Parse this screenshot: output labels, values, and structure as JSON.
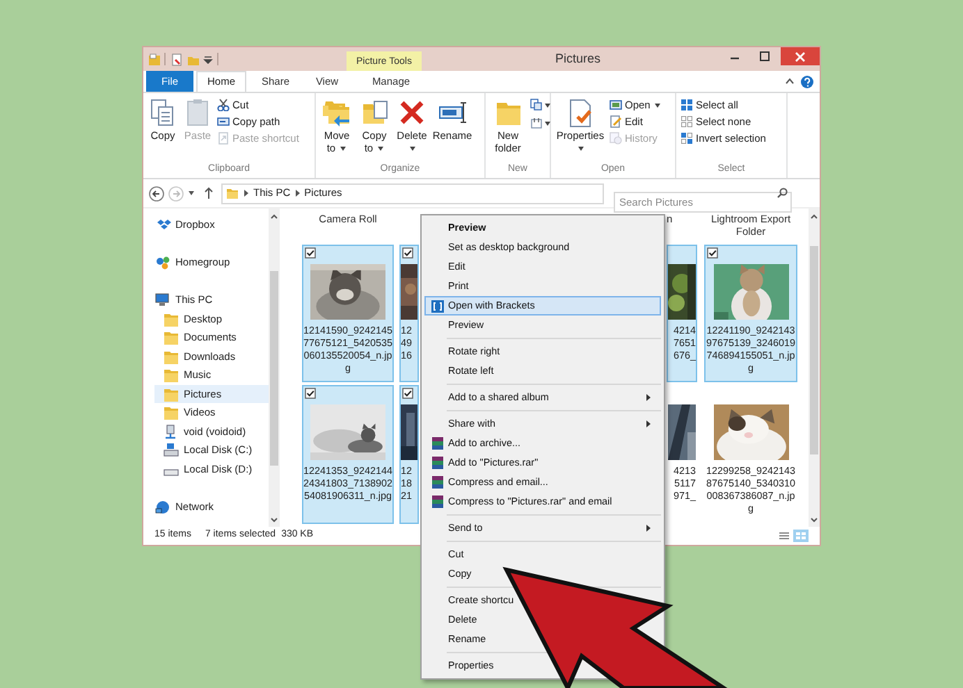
{
  "window": {
    "title": "Pictures",
    "context_label": "Picture Tools"
  },
  "tabs": [
    {
      "label": "File",
      "kind": "file",
      "selected": false
    },
    {
      "label": "Home",
      "kind": "tab",
      "selected": true
    },
    {
      "label": "Share",
      "kind": "tab",
      "selected": false
    },
    {
      "label": "View",
      "kind": "tab",
      "selected": false
    },
    {
      "label": "Manage",
      "kind": "tab",
      "selected": false
    }
  ],
  "ribbon_groups": [
    {
      "name": "Clipboard",
      "commands": [
        {
          "label": "Copy",
          "kind": "large",
          "disabled": false,
          "dropdown": false
        },
        {
          "label": "Paste",
          "kind": "large",
          "disabled": true,
          "dropdown": false
        },
        {
          "label": "Cut",
          "kind": "small",
          "disabled": false,
          "dropdown": false
        },
        {
          "label": "Copy path",
          "kind": "small",
          "disabled": false,
          "dropdown": false
        },
        {
          "label": "Paste shortcut",
          "kind": "small",
          "disabled": true,
          "dropdown": false
        }
      ]
    },
    {
      "name": "Organize",
      "commands": [
        {
          "label": "Move to",
          "kind": "large",
          "disabled": false,
          "dropdown": true
        },
        {
          "label": "Copy to",
          "kind": "large",
          "disabled": false,
          "dropdown": true
        },
        {
          "label": "Delete",
          "kind": "large",
          "disabled": false,
          "dropdown": true
        },
        {
          "label": "Rename",
          "kind": "large",
          "disabled": false,
          "dropdown": false
        }
      ]
    },
    {
      "name": "New",
      "commands": [
        {
          "label": "New folder",
          "kind": "large",
          "disabled": false,
          "dropdown": false
        }
      ]
    },
    {
      "name": "Open",
      "commands": [
        {
          "label": "Properties",
          "kind": "large",
          "disabled": false,
          "dropdown": true
        },
        {
          "label": "Open",
          "kind": "small",
          "disabled": false,
          "dropdown": true
        },
        {
          "label": "Edit",
          "kind": "small",
          "disabled": false,
          "dropdown": false
        },
        {
          "label": "History",
          "kind": "small",
          "disabled": true,
          "dropdown": false
        }
      ]
    },
    {
      "name": "Select",
      "commands": [
        {
          "label": "Select all",
          "kind": "small",
          "disabled": false,
          "dropdown": false
        },
        {
          "label": "Select none",
          "kind": "small",
          "disabled": false,
          "dropdown": false
        },
        {
          "label": "Invert selection",
          "kind": "small",
          "disabled": false,
          "dropdown": false
        }
      ]
    }
  ],
  "address": {
    "path": [
      "This PC",
      "Pictures"
    ],
    "search_placeholder": "Search Pictures"
  },
  "navigation": [
    {
      "label": "Dropbox",
      "kind": "cloud",
      "selected": false
    },
    {
      "label": "Homegroup",
      "kind": "group",
      "selected": false
    },
    {
      "label": "This PC",
      "kind": "computer",
      "selected": false,
      "children": [
        {
          "label": "Desktop",
          "kind": "folder",
          "selected": false
        },
        {
          "label": "Documents",
          "kind": "folder",
          "selected": false
        },
        {
          "label": "Downloads",
          "kind": "folder",
          "selected": false
        },
        {
          "label": "Music",
          "kind": "folder",
          "selected": false
        },
        {
          "label": "Pictures",
          "kind": "folder",
          "selected": true
        },
        {
          "label": "Videos",
          "kind": "folder",
          "selected": false
        },
        {
          "label": "void (voidoid)",
          "kind": "network_drive",
          "selected": false
        },
        {
          "label": "Local Disk (C:)",
          "kind": "system_disk",
          "selected": false
        },
        {
          "label": "Local Disk (D:)",
          "kind": "disk",
          "selected": false
        }
      ]
    },
    {
      "label": "Network",
      "kind": "network",
      "selected": false
    }
  ],
  "columns": [
    {
      "header": "Camera Roll",
      "tiles": [
        {
          "name": "12141590_924214577675121_5420535060135520054_n.jpg",
          "checked": true,
          "selected": true
        },
        {
          "name": "12241353_924214424341803_713890254081906311_n.jpg",
          "checked": true,
          "selected": true
        }
      ]
    },
    {
      "tiles": [
        {
          "name_lines": [
            "12",
            "49",
            "16"
          ],
          "checked": true,
          "selected": true
        },
        {
          "name_lines": [
            "12",
            "18",
            "21"
          ],
          "checked": true,
          "selected": true
        }
      ]
    },
    {
      "header": "n",
      "tiles": [
        {
          "name_lines": [
            "4214",
            "7651",
            "676_"
          ],
          "selected": true
        },
        {
          "name_lines": [
            "4213",
            "5117",
            "971_"
          ],
          "selected": false
        }
      ]
    },
    {
      "header": "Lightroom Export Folder",
      "tiles": [
        {
          "name": "12241190_924214397675139_3246019746894155051_n.jpg",
          "checked": true,
          "selected": true
        },
        {
          "name": "12299258_924214387675140_5340310008367386087_n.jpg",
          "checked": false,
          "selected": false
        }
      ]
    }
  ],
  "status_bar": {
    "item_count": "15 items",
    "selection": "7 items selected",
    "size": "330 KB"
  },
  "context_menu": [
    [
      {
        "label": "Preview",
        "kind": "plain",
        "selected": false,
        "bold": true
      },
      {
        "label": "Set as desktop background",
        "kind": "plain",
        "selected": false
      },
      {
        "label": "Edit",
        "kind": "plain",
        "selected": false
      },
      {
        "label": "Print",
        "kind": "plain",
        "selected": false
      },
      {
        "label": "Open with Brackets",
        "kind": "app",
        "selected": true
      },
      {
        "label": "Preview",
        "kind": "plain",
        "selected": false
      }
    ],
    [
      {
        "label": "Rotate right",
        "kind": "plain",
        "selected": false
      },
      {
        "label": "Rotate left",
        "kind": "plain",
        "selected": false
      }
    ],
    [
      {
        "label": "Add to a shared album",
        "kind": "submenu",
        "selected": false
      }
    ],
    [
      {
        "label": "Share with",
        "kind": "submenu",
        "selected": false
      },
      {
        "label": "Add to archive...",
        "kind": "archive",
        "selected": false
      },
      {
        "label": "Add to \"Pictures.rar\"",
        "kind": "archive",
        "selected": false
      },
      {
        "label": "Compress and email...",
        "kind": "archive",
        "selected": false
      },
      {
        "label": "Compress to \"Pictures.rar\" and email",
        "kind": "archive",
        "selected": false
      }
    ],
    [
      {
        "label": "Send to",
        "kind": "submenu",
        "selected": false
      }
    ],
    [
      {
        "label": "Cut",
        "kind": "plain",
        "selected": false
      },
      {
        "label": "Copy",
        "kind": "plain",
        "selected": false
      }
    ],
    [
      {
        "label": "Create shortcu",
        "kind": "plain",
        "selected": false
      },
      {
        "label": "Delete",
        "kind": "plain",
        "selected": false
      },
      {
        "label": "Rename",
        "kind": "plain",
        "selected": false
      }
    ],
    [
      {
        "label": "Properties",
        "kind": "plain",
        "selected": false
      }
    ]
  ]
}
